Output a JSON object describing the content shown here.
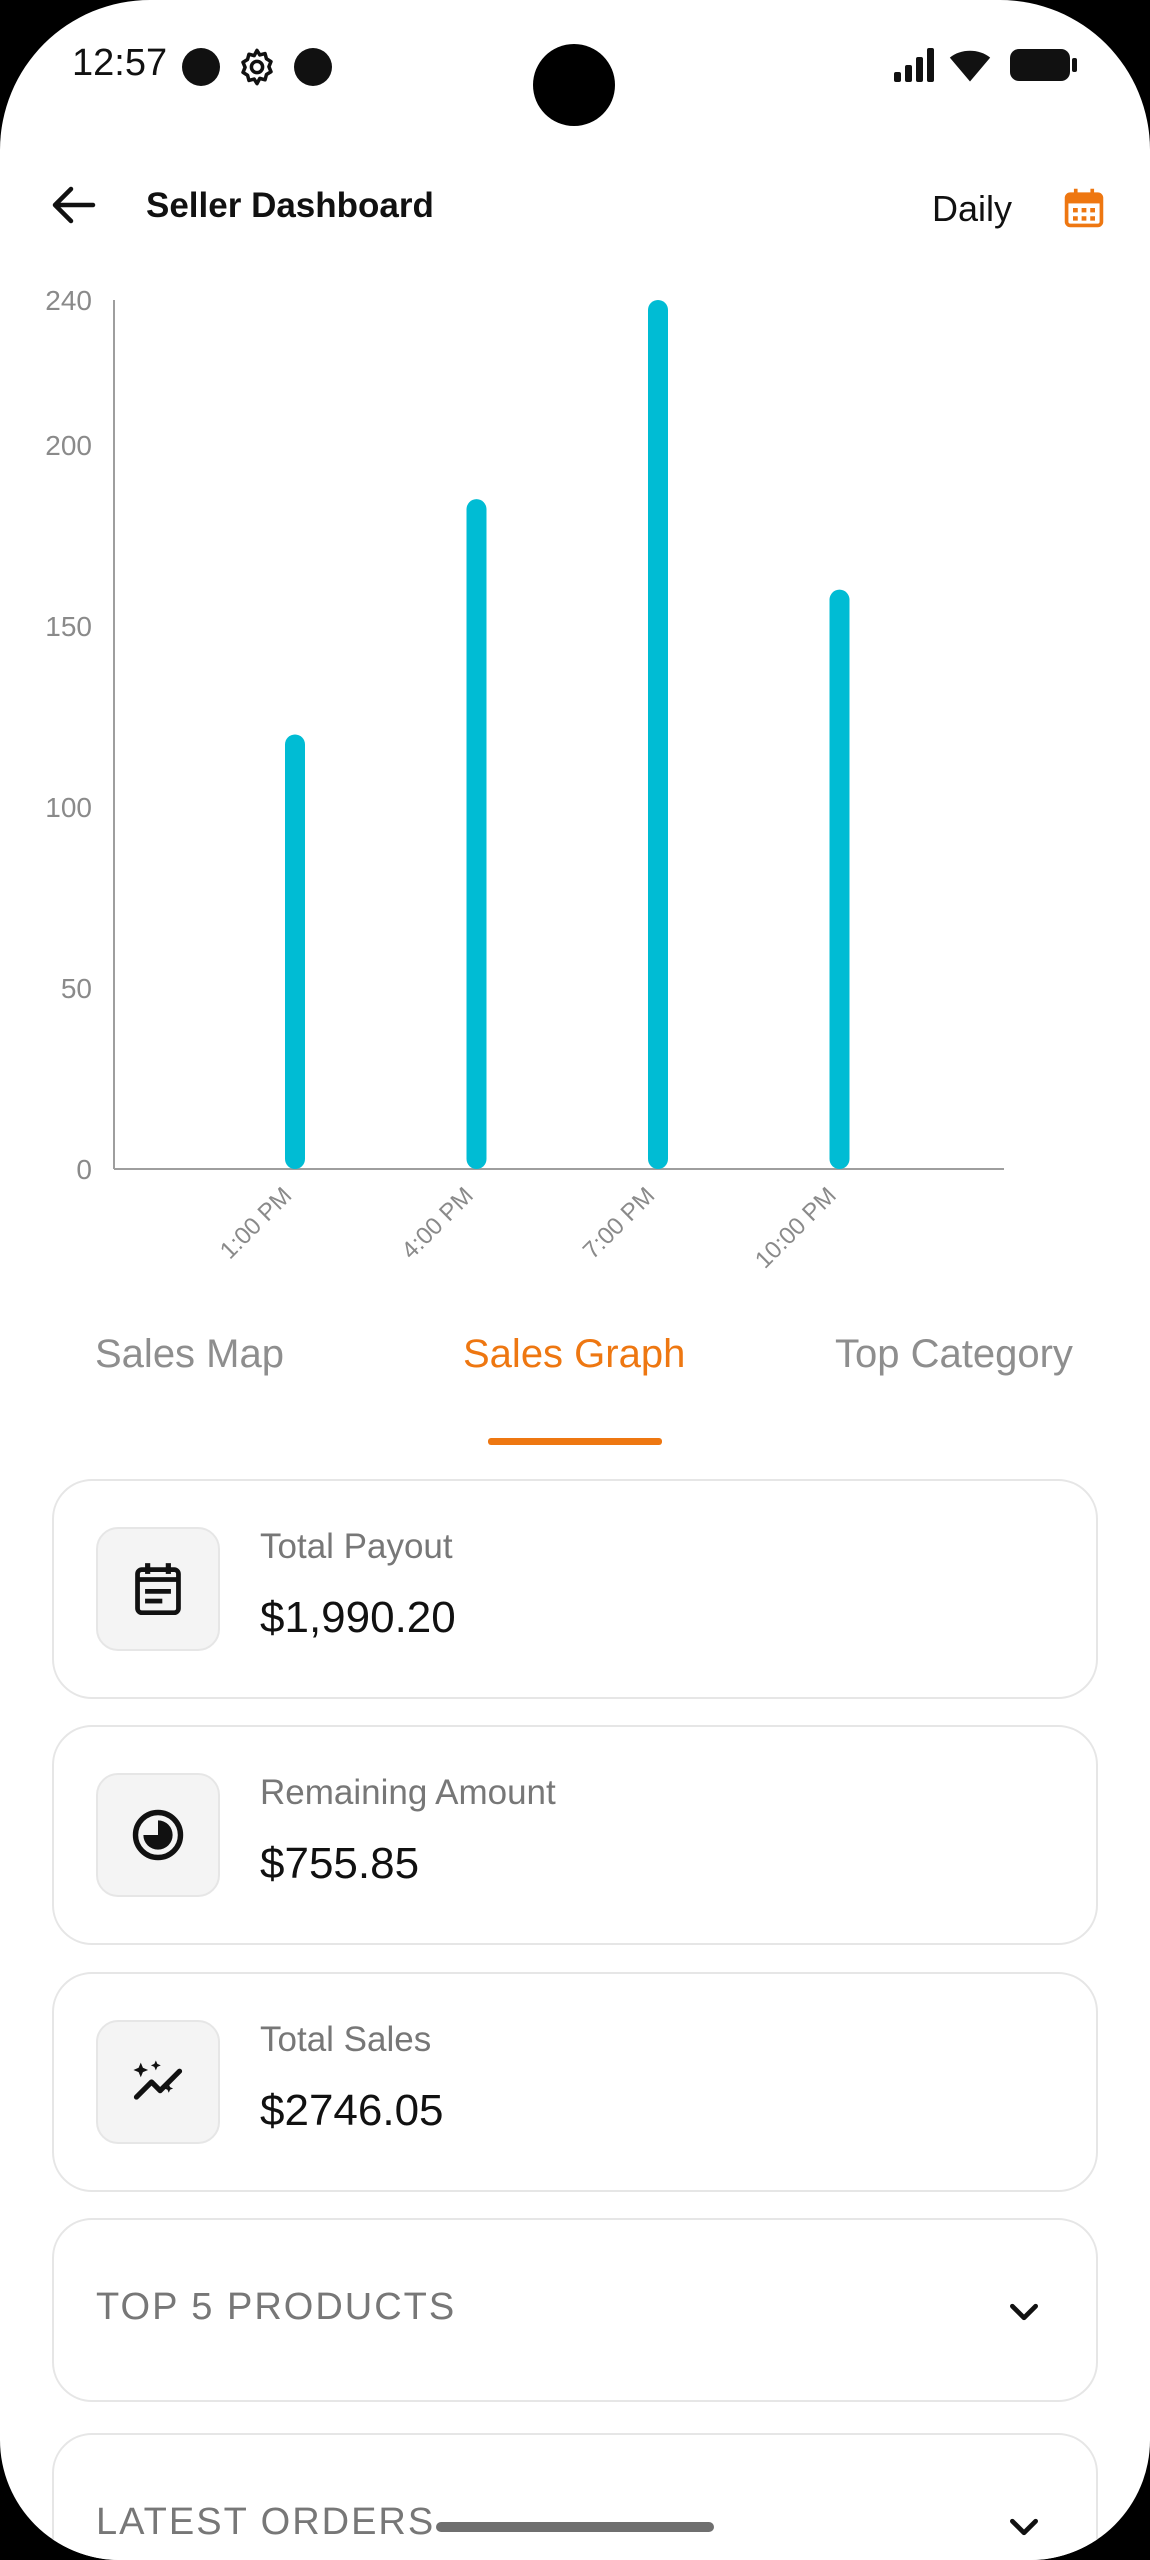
{
  "status_bar": {
    "time": "12:57"
  },
  "app_bar": {
    "title": "Seller Dashboard",
    "period": "Daily"
  },
  "colors": {
    "accent": "#ee7711",
    "bar": "#00bcd4"
  },
  "chart_data": {
    "type": "bar",
    "categories": [
      "1:00 PM",
      "4:00 PM",
      "7:00 PM",
      "10:00 PM"
    ],
    "values": [
      120,
      185,
      240,
      160
    ],
    "yticks": [
      0,
      50,
      100,
      150,
      200,
      240
    ],
    "ylim": [
      0,
      240
    ],
    "grid": false
  },
  "tabs": [
    {
      "label": "Sales Map",
      "active": false
    },
    {
      "label": "Sales Graph",
      "active": true
    },
    {
      "label": "Top Category",
      "active": false
    }
  ],
  "cards": [
    {
      "label": "Total Payout",
      "value": "$1,990.20",
      "icon": "calendar-note-icon"
    },
    {
      "label": "Remaining Amount",
      "value": "$755.85",
      "icon": "pie-clock-icon"
    },
    {
      "label": "Total Sales",
      "value": "$2746.05",
      "icon": "sparkle-trend-icon"
    }
  ],
  "sections": [
    {
      "title": "TOP 5 PRODUCTS"
    },
    {
      "title": "LATEST ORDERS"
    }
  ]
}
